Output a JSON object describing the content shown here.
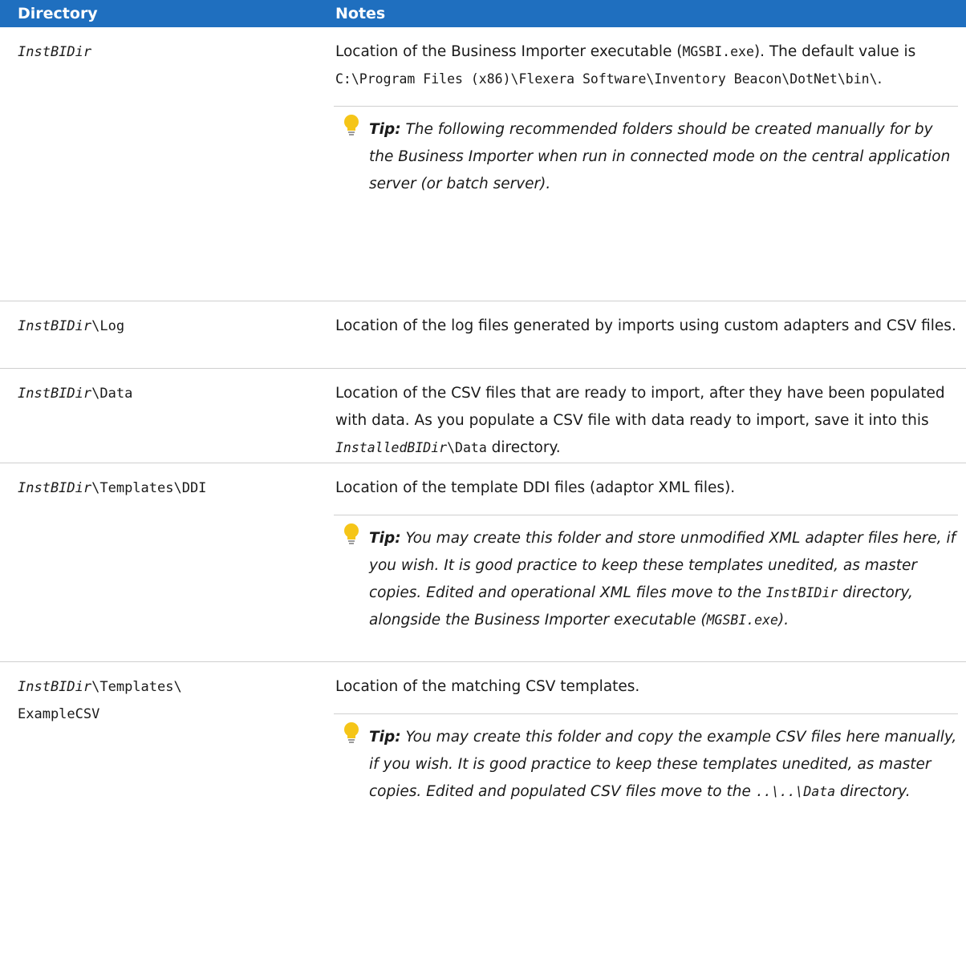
{
  "headers": {
    "directory": "Directory",
    "notes": "Notes"
  },
  "rows": [
    {
      "dir_italic": "InstBIDir",
      "dir_rest": "",
      "note_parts": [
        "Location of the Business Importer executable (",
        "MGSBI.exe",
        "). The default value is ",
        "C:\\Program Files (x86)\\Flexera Software\\Inventory Beacon\\DotNet\\bin\\",
        "."
      ],
      "tip_label": "Tip:",
      "tip_text": " The following recommended folders should be created manually for by the Business Importer when run in connected mode on the central application server (or batch server)."
    },
    {
      "dir_italic": "InstBIDir",
      "dir_rest": "\\Log",
      "note": "Location of the log files generated by imports using custom adapters and CSV files."
    },
    {
      "dir_italic": "InstBIDir",
      "dir_rest": "\\Data",
      "note_parts": [
        "Location of the CSV files that are ready to import, after they have been populated with data. As you populate a CSV file with data ready to import, save it into this ",
        "InstalledBIDir",
        "\\Data",
        " directory."
      ]
    },
    {
      "dir_italic": "InstBIDir",
      "dir_rest": "\\Templates\\DDI",
      "note": "Location of the template DDI files (adaptor XML files).",
      "tip_label": "Tip:",
      "tip_parts": [
        " You may create this folder and store unmodified XML adapter files here, if you wish. It is good practice to keep these templates unedited, as master copies. Edited and operational XML files move to the ",
        "InstBIDir",
        " directory, alongside the Business Importer executable (",
        "MGSBI.exe",
        ")."
      ]
    },
    {
      "dir_italic": "InstBIDir",
      "dir_rest": "\\Templates\\",
      "dir_line2": "ExampleCSV",
      "note": "Location of the matching CSV templates.",
      "tip_label": "Tip:",
      "tip_parts": [
        " You may create this folder and copy the example CSV files here manually, if you wish. It is good practice to keep these templates unedited, as master copies. Edited and populated CSV files move to the ",
        "..\\..\\",
        "Data",
        " directory."
      ]
    }
  ],
  "colors": {
    "header_bg": "#1f6fbf",
    "tip_bulb": "#f5c518"
  },
  "icons": {
    "tip": "lightbulb-icon"
  }
}
